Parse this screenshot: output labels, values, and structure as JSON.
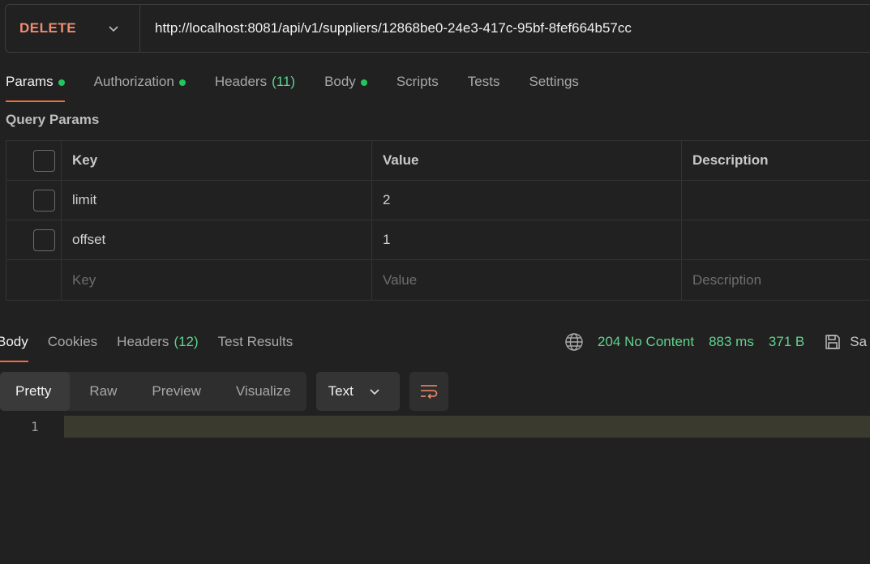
{
  "request": {
    "method": "DELETE",
    "url": "http://localhost:8081/api/v1/suppliers/12868be0-24e3-417c-95bf-8fef664b57cc"
  },
  "request_tabs": [
    {
      "label": "Params",
      "dot": true
    },
    {
      "label": "Authorization",
      "dot": true
    },
    {
      "label": "Headers",
      "count": "(11)"
    },
    {
      "label": "Body",
      "dot": true
    },
    {
      "label": "Scripts"
    },
    {
      "label": "Tests"
    },
    {
      "label": "Settings"
    }
  ],
  "query_params": {
    "title": "Query Params",
    "columns": {
      "key": "Key",
      "value": "Value",
      "description": "Description"
    },
    "rows": [
      {
        "key": "limit",
        "value": "2",
        "description": ""
      },
      {
        "key": "offset",
        "value": "1",
        "description": ""
      }
    ],
    "placeholder": {
      "key": "Key",
      "value": "Value",
      "description": "Description"
    }
  },
  "response_tabs": [
    {
      "label": "Body"
    },
    {
      "label": "Cookies"
    },
    {
      "label": "Headers",
      "count": "(12)"
    },
    {
      "label": "Test Results"
    }
  ],
  "response_status": {
    "status": "204 No Content",
    "time": "883 ms",
    "size": "371 B",
    "save_label": "Sa"
  },
  "view_modes": [
    "Pretty",
    "Raw",
    "Preview",
    "Visualize"
  ],
  "format": "Text",
  "editor": {
    "line_numbers": [
      "1"
    ]
  },
  "colors": {
    "accent": "#f26b3a",
    "method": "#f08d6f",
    "success": "#5fd38d",
    "dot": "#22c55e"
  }
}
